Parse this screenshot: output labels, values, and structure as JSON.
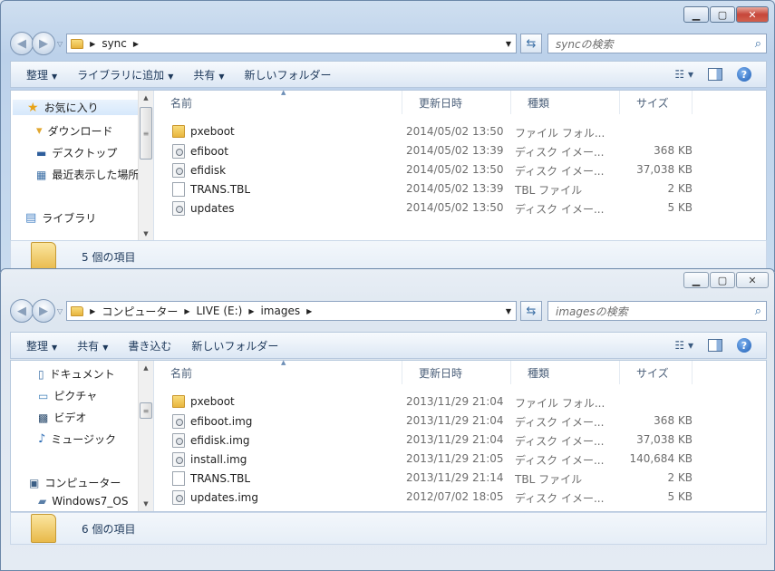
{
  "window1": {
    "breadcrumb": [
      "sync"
    ],
    "search_placeholder": "syncの検索",
    "commands": [
      "整理",
      "ライブラリに追加",
      "共有",
      "新しいフォルダー"
    ],
    "nav_items": [
      {
        "label": "お気に入り",
        "icon": "star-icon"
      },
      {
        "label": "ダウンロード",
        "icon": "download-folder-icon"
      },
      {
        "label": "デスクトップ",
        "icon": "desktop-icon"
      },
      {
        "label": "最近表示した場所",
        "icon": "recent-places-icon"
      },
      {
        "label": "ライブラリ",
        "icon": "library-icon"
      }
    ],
    "columns": [
      "名前",
      "更新日時",
      "種類",
      "サイズ"
    ],
    "files": [
      {
        "name": "pxeboot",
        "date": "2014/05/02 13:50",
        "type": "ファイル フォル...",
        "size": "",
        "icon": "folder-icon"
      },
      {
        "name": "efiboot",
        "date": "2014/05/02 13:39",
        "type": "ディスク イメー...",
        "size": "368 KB",
        "icon": "disk-image-icon"
      },
      {
        "name": "efidisk",
        "date": "2014/05/02 13:50",
        "type": "ディスク イメー...",
        "size": "37,038 KB",
        "icon": "disk-image-icon"
      },
      {
        "name": "TRANS.TBL",
        "date": "2014/05/02 13:39",
        "type": "TBL ファイル",
        "size": "2 KB",
        "icon": "file-icon"
      },
      {
        "name": "updates",
        "date": "2014/05/02 13:50",
        "type": "ディスク イメー...",
        "size": "5 KB",
        "icon": "disk-image-icon"
      }
    ],
    "item_count": "5 個の項目"
  },
  "window2": {
    "breadcrumb": [
      "コンピューター",
      "LIVE (E:)",
      "images"
    ],
    "search_placeholder": "imagesの検索",
    "commands": [
      "整理",
      "共有",
      "書き込む",
      "新しいフォルダー"
    ],
    "nav_items": [
      {
        "label": "ドキュメント",
        "icon": "documents-icon"
      },
      {
        "label": "ピクチャ",
        "icon": "pictures-icon"
      },
      {
        "label": "ビデオ",
        "icon": "video-icon"
      },
      {
        "label": "ミュージック",
        "icon": "music-icon"
      },
      {
        "label": "コンピューター",
        "icon": "computer-icon"
      },
      {
        "label": "Windows7_OS",
        "icon": "drive-icon"
      }
    ],
    "columns": [
      "名前",
      "更新日時",
      "種類",
      "サイズ"
    ],
    "files": [
      {
        "name": "pxeboot",
        "date": "2013/11/29 21:04",
        "type": "ファイル フォル...",
        "size": "",
        "icon": "folder-icon"
      },
      {
        "name": "efiboot.img",
        "date": "2013/11/29 21:04",
        "type": "ディスク イメー...",
        "size": "368 KB",
        "icon": "disk-image-icon"
      },
      {
        "name": "efidisk.img",
        "date": "2013/11/29 21:04",
        "type": "ディスク イメー...",
        "size": "37,038 KB",
        "icon": "disk-image-icon"
      },
      {
        "name": "install.img",
        "date": "2013/11/29 21:05",
        "type": "ディスク イメー...",
        "size": "140,684 KB",
        "icon": "disk-image-icon"
      },
      {
        "name": "TRANS.TBL",
        "date": "2013/11/29 21:14",
        "type": "TBL ファイル",
        "size": "2 KB",
        "icon": "file-icon"
      },
      {
        "name": "updates.img",
        "date": "2012/07/02 18:05",
        "type": "ディスク イメー...",
        "size": "5 KB",
        "icon": "disk-image-icon"
      }
    ],
    "item_count": "6 個の項目"
  }
}
